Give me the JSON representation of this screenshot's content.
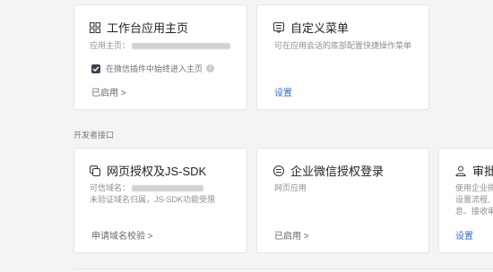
{
  "cards_top": {
    "workbench": {
      "title": "工作台应用主页",
      "home_label": "应用主页：",
      "checkbox_label": "在微信插件中始终进入主页",
      "status": "已启用 >"
    },
    "custom_menu": {
      "title": "自定义菜单",
      "desc": "可在应用会话的底部配置快捷操作菜单",
      "action": "设置"
    }
  },
  "section_label": "开发者接口",
  "cards_bottom": {
    "web_auth": {
      "title": "网页授权及JS-SDK",
      "domain_label": "可信域名：",
      "note": "未验证域名归属，JS-SDK功能受限",
      "action": "申请域名校验 >"
    },
    "wecom_login": {
      "title": "企业微信授权登录",
      "desc": "网页应用",
      "status": "已启用 >"
    },
    "approval": {
      "title": "审批",
      "line1": "使用企业微",
      "line2": "设置流程,",
      "line3": "息、接收审",
      "action": "设置"
    }
  },
  "icons": [
    "grid-icon",
    "menu-icon",
    "link-icon",
    "swap-icon",
    "person-icon",
    "check-icon",
    "info-icon"
  ]
}
